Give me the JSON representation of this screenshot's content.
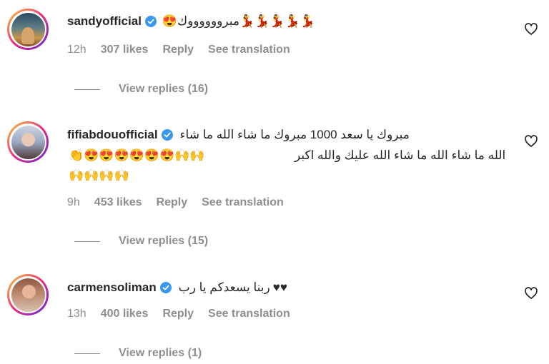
{
  "comments": [
    {
      "username": "sandyofficial",
      "text": "مبرووووووك",
      "emoji_prefix": "😍",
      "emoji_suffix": "💃💃💃💃💃",
      "time": "12h",
      "likes": "307 likes",
      "reply": "Reply",
      "translate": "See translation",
      "view_replies": "View replies (16)"
    },
    {
      "username": "fifiabdouofficial",
      "line1": "مبروك يا سعد 1000 مبروك ما شاء الله ما شاء",
      "line2_text": "الله ما شاء الله ما شاء الله عليك والله اكبر",
      "line2_emojis": "👏😍😍😍😍😍😍🙌🙌",
      "line3": "🙌🙌🙌🙌",
      "time": "9h",
      "likes": "453 likes",
      "reply": "Reply",
      "translate": "See translation",
      "view_replies": "View replies (15)"
    },
    {
      "username": "carmensoliman",
      "text": "ربنا يسعدكم يا رب",
      "emoji_suffix": "♥♥",
      "time": "13h",
      "likes": "400 likes",
      "reply": "Reply",
      "translate": "See translation",
      "view_replies": "View replies (1)"
    }
  ],
  "colors": {
    "text": "#262626",
    "secondary": "#8e8e8e",
    "verified": "#3897f0"
  },
  "icons": [
    "verified-badge-icon",
    "heart-icon"
  ]
}
